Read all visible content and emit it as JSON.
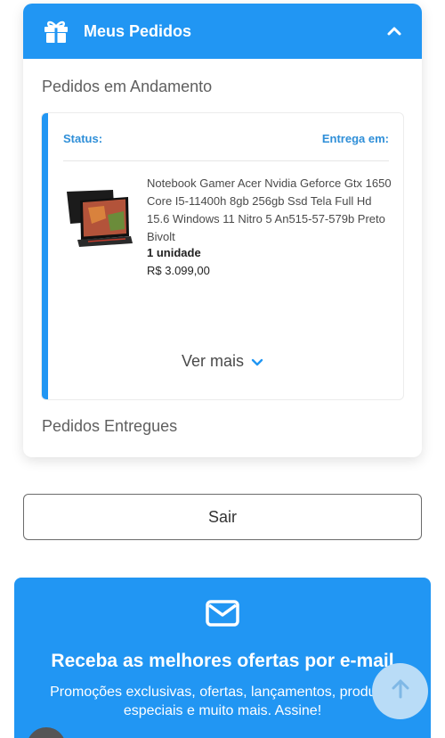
{
  "orders_card": {
    "title": "Meus Pedidos",
    "in_progress_title": "Pedidos em Andamento",
    "delivered_title": "Pedidos Entregues"
  },
  "order": {
    "status_label": "Status:",
    "delivery_label": "Entrega em:",
    "product_name": "Notebook Gamer Acer Nvidia Geforce Gtx 1650 Core I5-11400h 8gb 256gb Ssd Tela Full Hd 15.6 Windows 11 Nitro 5 An515-57-579b Preto Bivolt",
    "quantity": "1 unidade",
    "price": "R$ 3.099,00",
    "see_more": "Ver mais"
  },
  "logout_button": "Sair",
  "newsletter": {
    "title": "Receba as melhores ofertas por e-mail",
    "text": "Promoções exclusivas, ofertas, lançamentos, produtos especiais e muito mais. Assine!"
  },
  "colors": {
    "accent": "#2196f3",
    "link": "#2f8fd8"
  },
  "icons": {
    "header": "gift-icon",
    "collapse": "chevron-up-icon",
    "expand": "chevron-down-icon",
    "newsletter": "mail-icon",
    "scroll": "arrow-up-icon"
  }
}
